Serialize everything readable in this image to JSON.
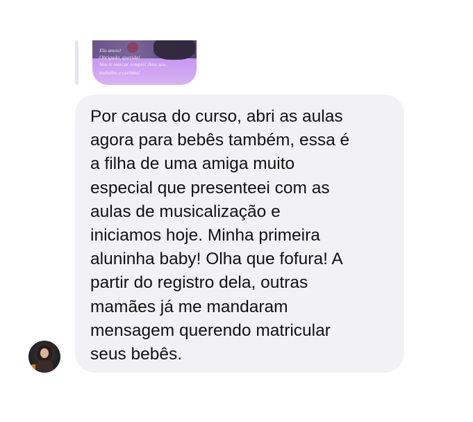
{
  "reply_preview": {
    "caption_lines": [
      "Ela amou!",
      "Obrigada, querida!",
      "Vou te marcar sempre! Amo seu",
      "trabalho e carinho!"
    ]
  },
  "message": {
    "lines": [
      "Por causa do curso, abri as aulas",
      "agora para bebês também, essa é",
      "a filha de uma amiga muito",
      "especial que presenteei com as",
      "aulas de musicalização e",
      "iniciamos hoje. Minha primeira",
      "aluninha baby! Olha que fofura! A",
      "partir do registro dela, outras",
      "mamães já me mandaram",
      "mensagem querendo matricular",
      "seus bebês."
    ]
  },
  "colors": {
    "bubble_background": "#f2f2f4",
    "text": "#111111",
    "reply_bar": "#e6e6ea"
  }
}
